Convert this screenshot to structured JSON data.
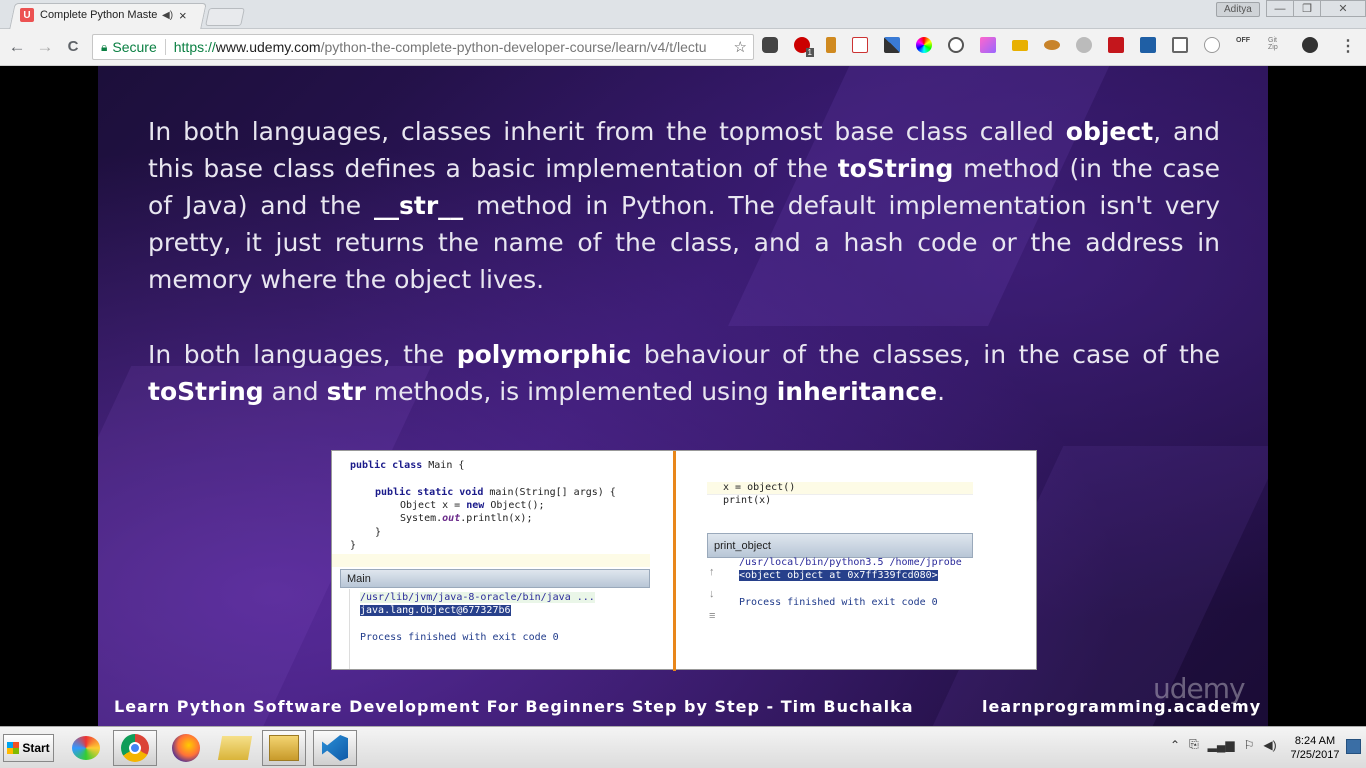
{
  "browser": {
    "tab": {
      "title": "Complete Python Maste",
      "favicon": "U"
    },
    "profile": "Aditya",
    "window_controls": {
      "minimize": "—",
      "restore": "❐",
      "close": "✕"
    },
    "nav": {
      "back": "←",
      "forward": "→",
      "reload": "C"
    },
    "omnibox": {
      "security_label": "Secure",
      "url_scheme": "https://",
      "url_host": "www.udemy.com",
      "url_path": "/python-the-complete-python-developer-course/learn/v4/t/lectu"
    },
    "menu": "⋮",
    "extensions": [
      "pocket-icon",
      "ublock-icon",
      "flag-icon",
      "notes-icon",
      "pen-icon",
      "color-wheel-icon",
      "recycle-icon",
      "gradient-icon",
      "folder-icon",
      "food-icon",
      "shield-icon",
      "pdf-icon",
      "save-icon",
      "copy-icon",
      "circle-icon",
      "off-icon",
      "zip-icon",
      "adblock-icon"
    ],
    "extension_badge": "1",
    "extension_off_label": "OFF",
    "extension_zip_label": "Git Zip"
  },
  "slide": {
    "para1": {
      "t1": "In both languages, classes inherit from the topmost base class called ",
      "b1": "object",
      "t2": ", and this base class defines a basic implementation of the ",
      "b2": "toString",
      "t3": " method (in the case of Java) and the ",
      "b3": "__str__",
      "t4": " method in Python. The default implementation isn't very pretty, it just returns the name of the class, and a hash code or the address in memory where the object lives."
    },
    "para2": {
      "t1": "In both languages, the ",
      "b1": "polymorphic",
      "t2": " behaviour of the classes, in the case of the ",
      "b2": "toString",
      "t3": " and ",
      "b3": "str",
      "t4": " methods, is implemented using ",
      "b4": "inheritance",
      "t5": "."
    },
    "java": {
      "l1a": "public class",
      "l1b": " Main {",
      "l2a": "public static void",
      "l2b": " main(String[] args) {",
      "l3a": "Object x = ",
      "l3b": "new",
      "l3c": " Object();",
      "l4a": "System.",
      "l4b": "out",
      "l4c": ".println(x);",
      "l5": "}",
      "l6": "}",
      "run_header": "Main",
      "run_cmd": "/usr/lib/jvm/java-8-oracle/bin/java ...",
      "run_output": "java.lang.Object@677327b6",
      "run_exit": "Process finished with exit code 0"
    },
    "python": {
      "l1": "x = object()",
      "l2": "print(x)",
      "run_header": "print_object",
      "run_cmd": "/usr/local/bin/python3.5 /home/jprobe",
      "run_output": "<object object at 0x7ff339fcd080>",
      "run_exit": "Process finished with exit code 0"
    },
    "footer_title": "Learn Python Software Development For Beginners Step by Step - Tim Buchalka",
    "footer_site": "learnprogramming.academy",
    "watermark": "udemy"
  },
  "taskbar": {
    "start_label": "Start",
    "apps": [
      "paint-icon",
      "chrome-icon",
      "firefox-icon",
      "folder-icon",
      "explorer-icon",
      "vscode-icon"
    ],
    "clock_time": "8:24 AM",
    "clock_date": "7/25/2017"
  }
}
